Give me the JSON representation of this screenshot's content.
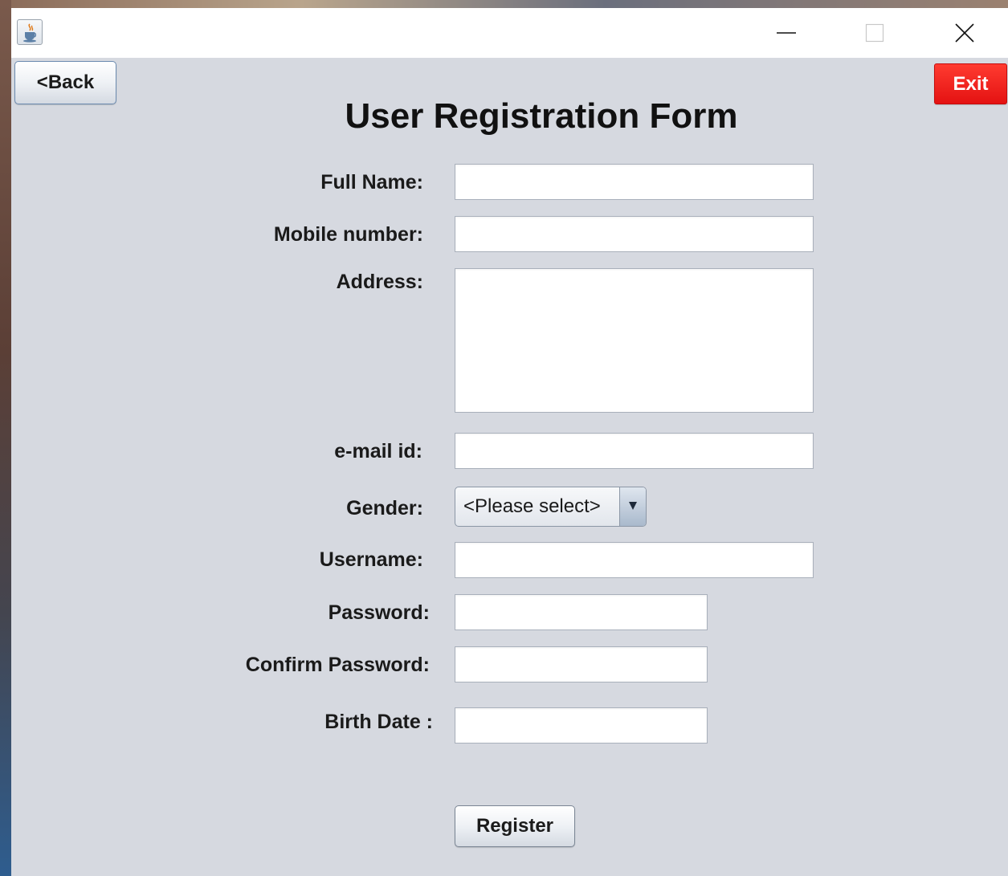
{
  "window": {
    "minimize_glyph": "minimize-icon",
    "maximize_glyph": "maximize-icon",
    "close_glyph": "close-icon",
    "app_icon": "java-cup-icon"
  },
  "nav": {
    "back_label": "<Back",
    "exit_label": "Exit",
    "exit_color": "#e81414"
  },
  "form": {
    "title": "User Registration Form",
    "labels": {
      "full_name": "Full Name:",
      "mobile": "Mobile number:",
      "address": "Address:",
      "email": "e-mail id:",
      "gender": "Gender:",
      "username": "Username:",
      "password": "Password:",
      "confirm_password": "Confirm Password:",
      "birth_date": "Birth Date :"
    },
    "values": {
      "full_name": "",
      "mobile": "",
      "address": "",
      "email": "",
      "username": "",
      "password": "",
      "confirm_password": "",
      "birth_date": ""
    },
    "gender": {
      "selected": "<Please select>"
    },
    "register_label": "Register"
  }
}
